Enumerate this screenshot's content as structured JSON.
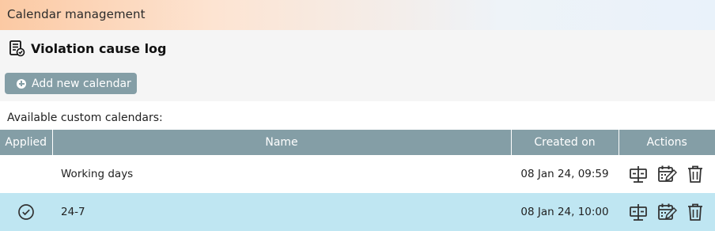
{
  "topbar": {
    "title": "Calendar management"
  },
  "header": {
    "title": "Violation cause log",
    "icon": "log-icon"
  },
  "toolbar": {
    "add_label": "Add new calendar"
  },
  "list": {
    "label": "Available custom calendars:"
  },
  "table": {
    "columns": [
      "Applied",
      "Name",
      "Created on",
      "Actions"
    ],
    "rows": [
      {
        "applied": false,
        "name": "Working days",
        "created_on": "08 Jan 24, 09:59"
      },
      {
        "applied": true,
        "name": "24-7",
        "created_on": "08 Jan 24, 10:00"
      }
    ],
    "action_icons": [
      "apply-calendar-icon",
      "edit-calendar-icon",
      "trash-icon"
    ]
  },
  "colors": {
    "accent": "#849ea6",
    "selected_row": "#bfe6f2",
    "header_bg": "#f5f5f5"
  }
}
